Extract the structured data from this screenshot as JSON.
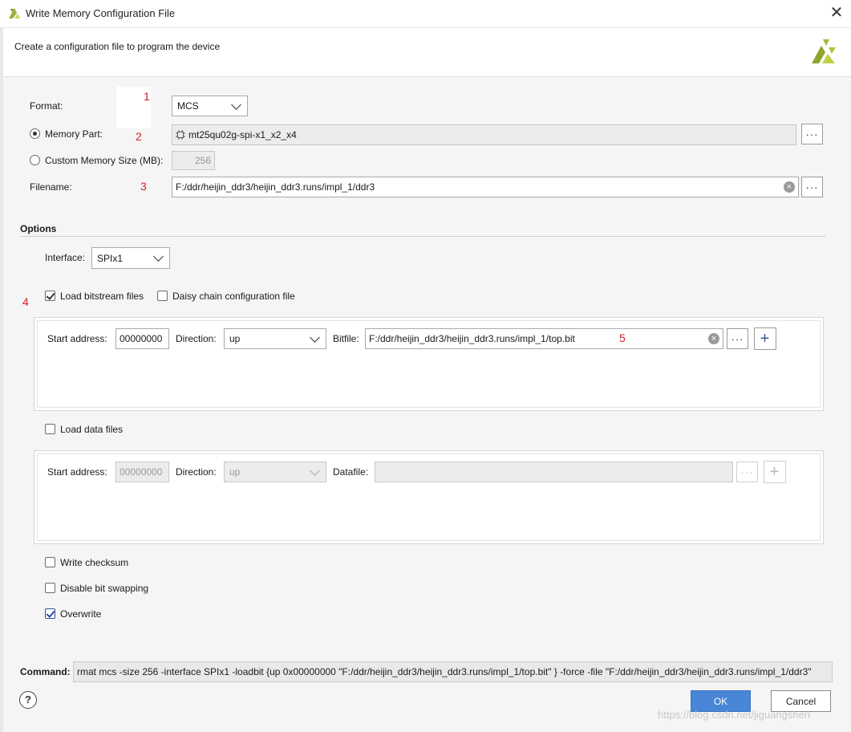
{
  "window": {
    "title": "Write Memory Configuration File",
    "close_glyph": "✕"
  },
  "header": {
    "description": "Create a configuration file to program the device"
  },
  "annotations": {
    "n1": "1",
    "n2": "2",
    "n3": "3",
    "n4": "4",
    "n5": "5"
  },
  "format": {
    "label": "Format:",
    "value": "MCS"
  },
  "memory_part": {
    "label": "Memory Part:",
    "value": "mt25qu02g-spi-x1_x2_x4",
    "selected": true
  },
  "custom_size": {
    "label": "Custom Memory Size (MB):",
    "value": "256"
  },
  "filename": {
    "label": "Filename:",
    "value": "F:/ddr/heijin_ddr3/heijin_ddr3.runs/impl_1/ddr3"
  },
  "browse_glyph": "···",
  "options": {
    "title": "Options",
    "interface_label": "Interface:",
    "interface_value": "SPIx1",
    "load_bitstream": {
      "label": "Load bitstream files",
      "checked": true
    },
    "daisy_chain": {
      "label": "Daisy chain configuration file",
      "checked": false
    }
  },
  "bitstream_row": {
    "start_label": "Start address:",
    "start_value": "00000000",
    "direction_label": "Direction:",
    "direction_value": "up",
    "file_label": "Bitfile:",
    "file_value": "F:/ddr/heijin_ddr3/heijin_ddr3.runs/impl_1/top.bit",
    "plus_glyph": "+"
  },
  "load_data": {
    "label": "Load data files",
    "checked": false
  },
  "data_row": {
    "start_label": "Start address:",
    "start_value": "00000000",
    "direction_label": "Direction:",
    "direction_value": "up",
    "file_label": "Datafile:",
    "file_value": "",
    "plus_glyph": "+"
  },
  "write_checksum": {
    "label": "Write checksum",
    "checked": false
  },
  "disable_swap": {
    "label": "Disable bit swapping",
    "checked": false
  },
  "overwrite": {
    "label": "Overwrite",
    "checked": true
  },
  "command": {
    "label": "Command:",
    "value": "rmat mcs -size 256 -interface SPIx1 -loadbit {up 0x00000000 \"F:/ddr/heijin_ddr3/heijin_ddr3.runs/impl_1/top.bit\" } -force -file \"F:/ddr/heijin_ddr3/heijin_ddr3.runs/impl_1/ddr3\""
  },
  "footer": {
    "help_glyph": "?",
    "ok_label": "OK",
    "cancel_label": "Cancel"
  },
  "watermark": "https://blog.csdn.net/jiguangshen",
  "colors": {
    "accent": "#4a86d8",
    "annotation": "#d0202a",
    "logo": "#9bb03a"
  }
}
